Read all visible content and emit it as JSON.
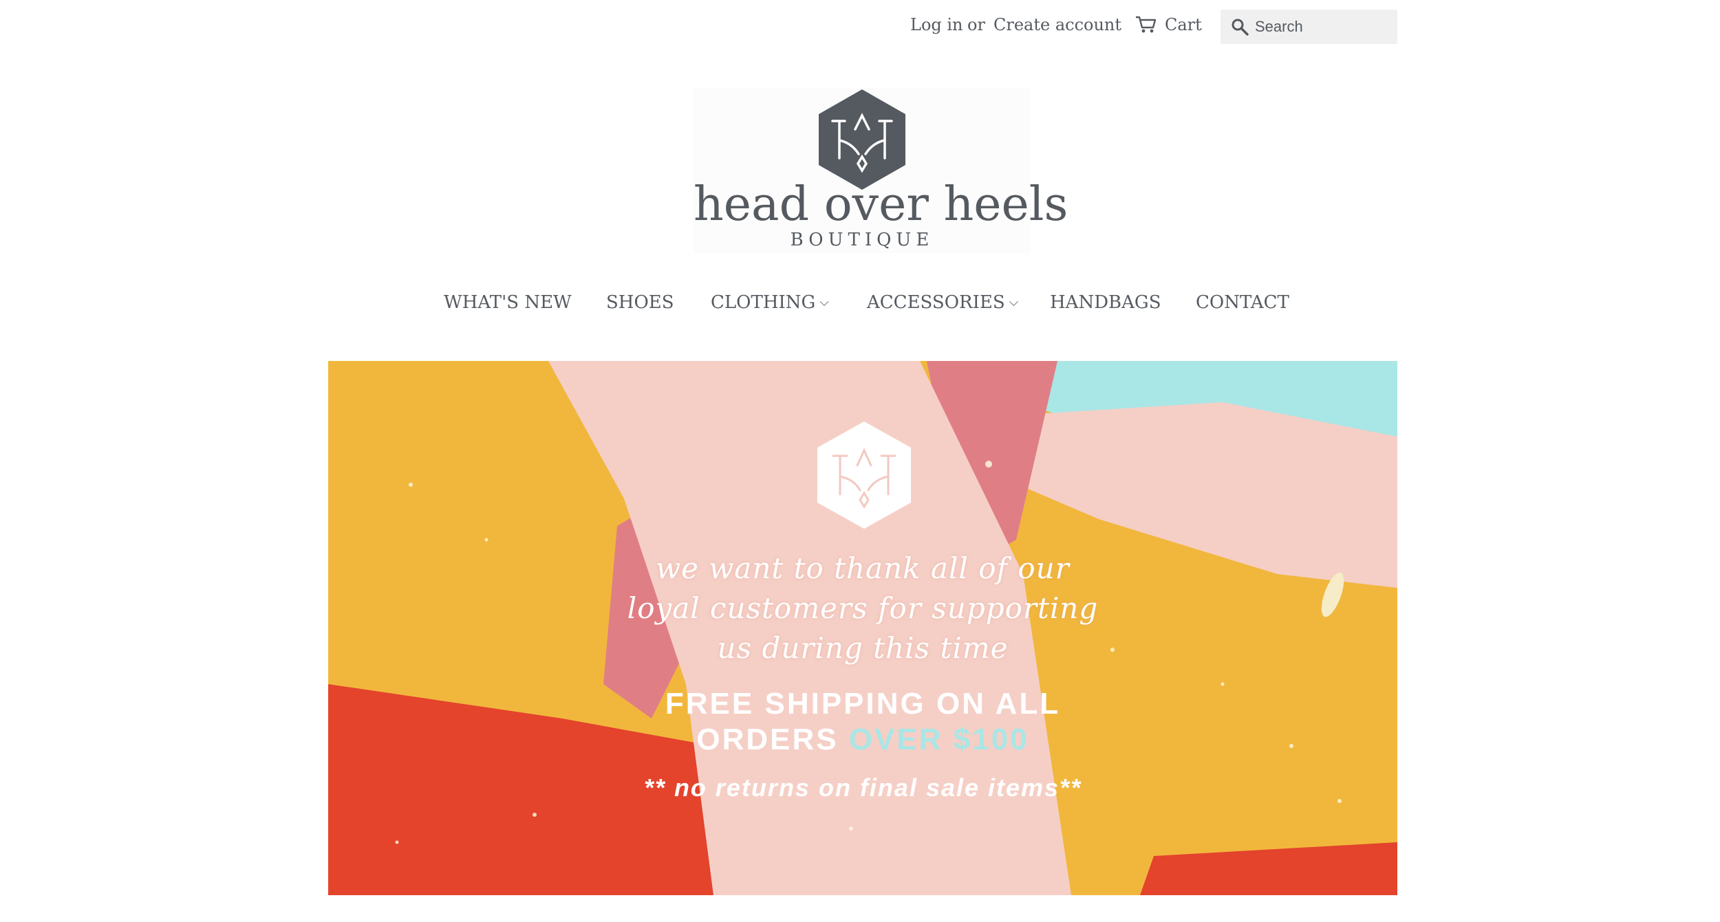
{
  "header": {
    "login_label": "Log in",
    "or_label": "or",
    "create_account_label": "Create account",
    "cart_label": "Cart",
    "cart_icon": "cart-icon",
    "search_icon": "search-icon",
    "search_placeholder": "Search"
  },
  "logo": {
    "name": "head over heels",
    "subtitle": "BOUTIQUE",
    "color": "#555a60"
  },
  "nav": {
    "items": [
      {
        "label": "WHAT'S NEW",
        "has_dropdown": false
      },
      {
        "label": "SHOES",
        "has_dropdown": false
      },
      {
        "label": "CLOTHING",
        "has_dropdown": true
      },
      {
        "label": "ACCESSORIES",
        "has_dropdown": true
      },
      {
        "label": "HANDBAGS",
        "has_dropdown": false
      },
      {
        "label": "CONTACT",
        "has_dropdown": false
      }
    ],
    "dropdown_glyph": "⌵"
  },
  "banner": {
    "script_lines": [
      "we want to thank all of our",
      "loyal customers for supporting",
      "us during this time"
    ],
    "promo_line1": "FREE SHIPPING ON ALL",
    "promo_line2_main": "ORDERS ",
    "promo_line2_accent": "OVER $100",
    "note": "** no returns on final sale items**",
    "colors": {
      "yellow": "#f1b73d",
      "pink": "#f5cfc6",
      "red": "#e4432c",
      "rose": "#e07e85",
      "aqua": "#a9e6e6",
      "accent": "#a9e6e6"
    }
  }
}
